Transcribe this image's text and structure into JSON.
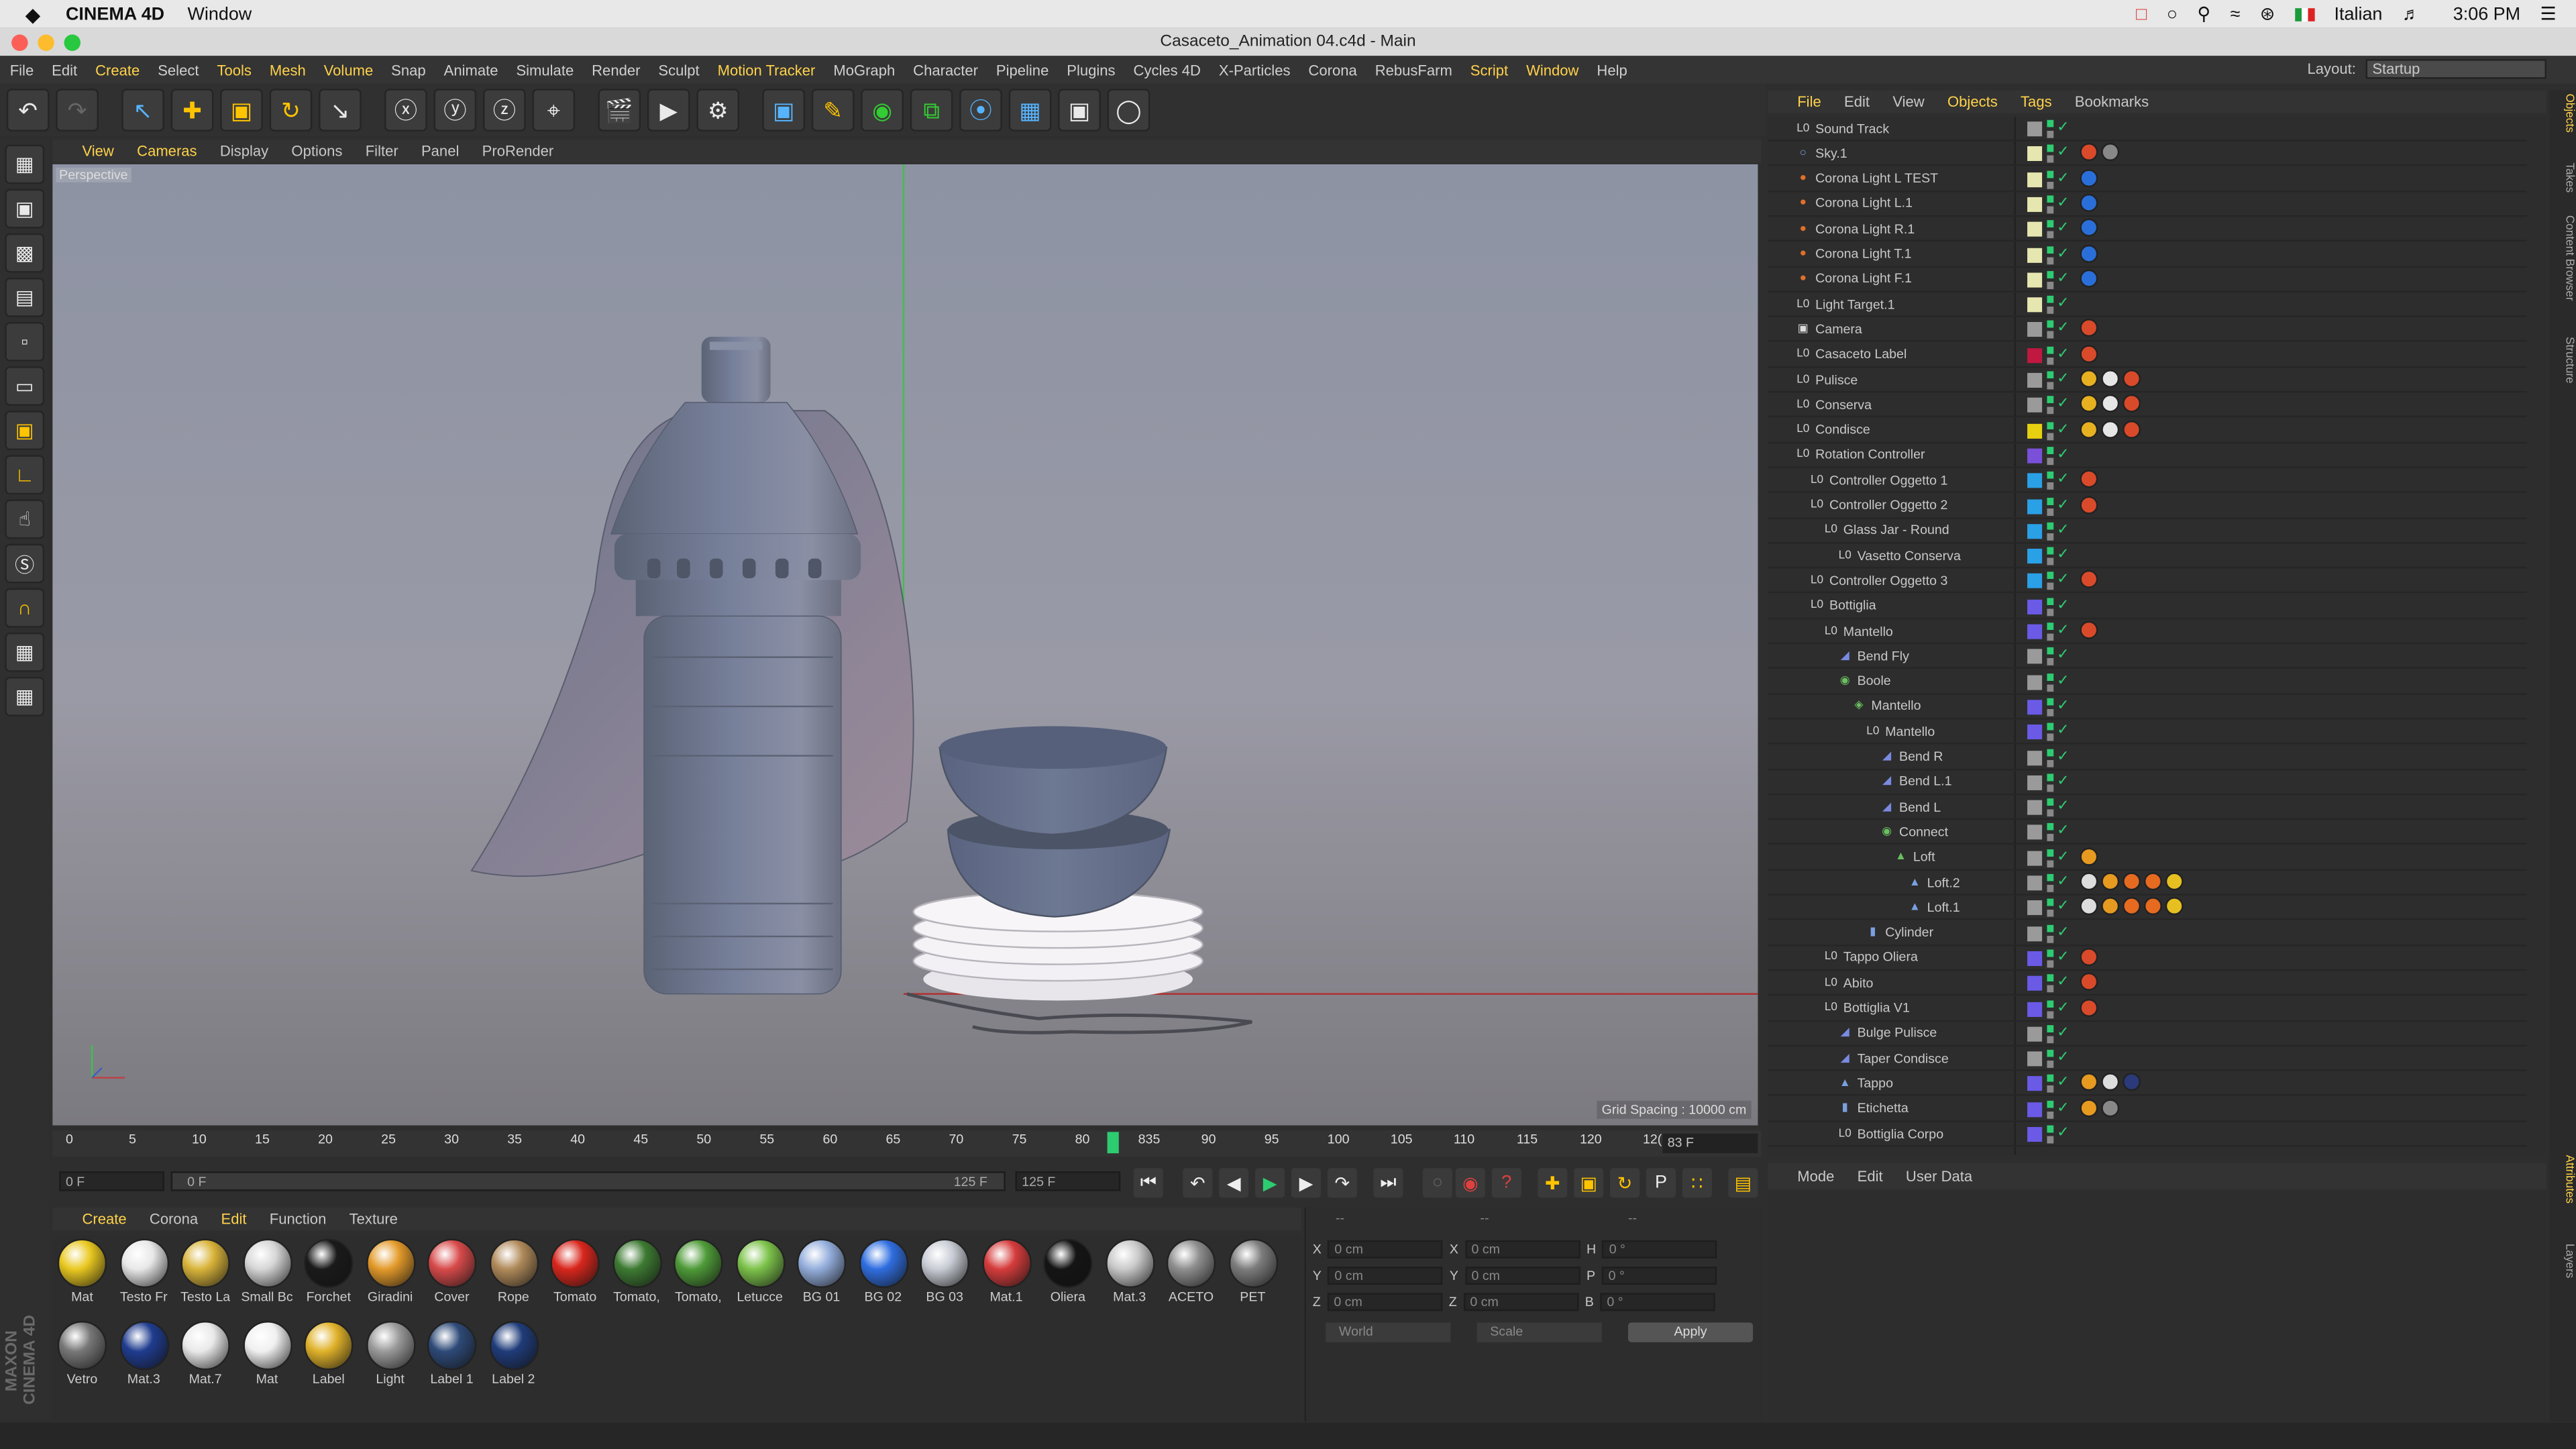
{
  "macbar": {
    "apple": "",
    "app_name": "CINEMA 4D",
    "window_menu": "Window",
    "language": "Italian",
    "time": "3:06 PM"
  },
  "titlebar": {
    "title": "Casaceto_Animation 04.c4d - Main"
  },
  "menubar": [
    "File",
    "Edit",
    "Create",
    "Select",
    "Tools",
    "Mesh",
    "Volume",
    "Snap",
    "Animate",
    "Simulate",
    "Render",
    "Sculpt",
    "Motion Tracker",
    "MoGraph",
    "Character",
    "Pipeline",
    "Plugins",
    "Cycles 4D",
    "X-Particles",
    "Corona",
    "RebusFarm",
    "Script",
    "Window",
    "Help"
  ],
  "menubar_highlight": [
    "Create",
    "Tools",
    "Mesh",
    "Volume",
    "Motion Tracker",
    "Script",
    "Window"
  ],
  "layout": {
    "label": "Layout:",
    "value": "Startup"
  },
  "viewport": {
    "menu": [
      "View",
      "Cameras",
      "Display",
      "Options",
      "Filter",
      "Panel",
      "ProRender"
    ],
    "label": "Perspective",
    "grid_spacing": "Grid Spacing : 10000 cm"
  },
  "timeline": {
    "ticks": [
      "0",
      "5",
      "10",
      "15",
      "20",
      "25",
      "30",
      "35",
      "40",
      "45",
      "50",
      "55",
      "60",
      "65",
      "70",
      "75",
      "80",
      "835",
      "90",
      "95",
      "100",
      "105",
      "110",
      "115",
      "120",
      "12("
    ],
    "current_frame": "83 F",
    "start_field": "0 F",
    "range_start": "0 F",
    "range_end": "125 F",
    "end_field": "125 F"
  },
  "materials": {
    "menu": [
      "Create",
      "Corona",
      "Edit",
      "Function",
      "Texture"
    ],
    "row1": [
      {
        "name": "Mat",
        "color": "#e9c820"
      },
      {
        "name": "Testo Fr",
        "color": "#e8e8e8"
      },
      {
        "name": "Testo La",
        "color": "#d9b43a"
      },
      {
        "name": "Small Bc",
        "color": "#d6d6d6"
      },
      {
        "name": "Forchet",
        "color": "#1a1a1a"
      },
      {
        "name": "Giradini",
        "color": "#e39a2a"
      },
      {
        "name": "Cover",
        "color": "#d84a4a"
      },
      {
        "name": "Rope",
        "color": "#b08a5a"
      },
      {
        "name": "Tomato",
        "color": "#d8261c"
      },
      {
        "name": "Tomato,",
        "color": "#3d7a32"
      },
      {
        "name": "Tomato,",
        "color": "#4e9a38"
      },
      {
        "name": "Letucce",
        "color": "#7cc24a"
      },
      {
        "name": "BG 01",
        "color": "#94aedc"
      },
      {
        "name": "BG 02",
        "color": "#2f6ee0"
      },
      {
        "name": "BG 03",
        "color": "#c8ccd4"
      },
      {
        "name": "Mat.1",
        "color": "#d63c3c"
      },
      {
        "name": "Oliera",
        "color": "#141414"
      },
      {
        "name": "Mat.3",
        "color": "#c9c9c9"
      },
      {
        "name": "ACETO",
        "color": "#8e8e8e"
      },
      {
        "name": "PET",
        "color": "#7c7c7c"
      }
    ],
    "row2": [
      {
        "name": "Vetro",
        "color": "#777777"
      },
      {
        "name": "Mat.3",
        "color": "#1f3c8f"
      },
      {
        "name": "Mat.7",
        "color": "#e9e9e9"
      },
      {
        "name": "Mat",
        "color": "#f0f0f0"
      },
      {
        "name": "Label",
        "color": "#e0b22a"
      },
      {
        "name": "Light",
        "color": "#9a9a9a"
      },
      {
        "name": "Label 1",
        "color": "#2e4a78"
      },
      {
        "name": "Label 2",
        "color": "#1f3c7a"
      }
    ]
  },
  "coords": {
    "headers": [
      "--",
      "--",
      "--"
    ],
    "rows": [
      {
        "axis": "X",
        "pos": "0 cm",
        "size_axis": "X",
        "size": "0 cm",
        "rot_axis": "H",
        "rot": "0 °"
      },
      {
        "axis": "Y",
        "pos": "0 cm",
        "size_axis": "Y",
        "size": "0 cm",
        "rot_axis": "P",
        "rot": "0 °"
      },
      {
        "axis": "Z",
        "pos": "0 cm",
        "size_axis": "Z",
        "size": "0 cm",
        "rot_axis": "B",
        "rot": "0 °"
      }
    ],
    "world": "World",
    "scale": "Scale",
    "apply": "Apply"
  },
  "objects": {
    "menu": [
      "File",
      "Edit",
      "View",
      "Objects",
      "Tags",
      "Bookmarks"
    ],
    "menu_highlight": [
      "File",
      "Objects",
      "Tags"
    ],
    "rows": [
      {
        "name": "Sound Track",
        "indent": 0,
        "icon": "null",
        "vis": "#9a9a9a",
        "tags": []
      },
      {
        "name": "Sky.1",
        "indent": 0,
        "icon": "sky",
        "vis": "#e6e6b0",
        "tags": [
          "#d94a2a",
          "#888888"
        ]
      },
      {
        "name": "Corona Light L TEST",
        "indent": 0,
        "icon": "light",
        "vis": "#e6e6b0",
        "tags": [
          "#2a6fd9"
        ]
      },
      {
        "name": "Corona Light L.1",
        "indent": 0,
        "icon": "light",
        "vis": "#e6e6b0",
        "tags": [
          "#2a6fd9"
        ]
      },
      {
        "name": "Corona Light R.1",
        "indent": 0,
        "icon": "light",
        "vis": "#e6e6b0",
        "tags": [
          "#2a6fd9"
        ]
      },
      {
        "name": "Corona Light T.1",
        "indent": 0,
        "icon": "light",
        "vis": "#e6e6b0",
        "tags": [
          "#2a6fd9"
        ]
      },
      {
        "name": "Corona Light F.1",
        "indent": 0,
        "icon": "light",
        "vis": "#e6e6b0",
        "tags": [
          "#2a6fd9"
        ]
      },
      {
        "name": "Light Target.1",
        "indent": 0,
        "icon": "null",
        "vis": "#e6e6b0",
        "tags": []
      },
      {
        "name": "Camera",
        "indent": 0,
        "icon": "camera",
        "vis": "#9a9a9a",
        "tags": [
          "#d94a2a"
        ]
      },
      {
        "name": "Casaceto Label",
        "indent": 0,
        "icon": "null",
        "vis": "#c01840",
        "tags": [
          "#d94a2a"
        ]
      },
      {
        "name": "Pulisce",
        "indent": 0,
        "icon": "null",
        "vis": "#9a9a9a",
        "tags": [
          "#e6b020",
          "#e6e6e6",
          "#d94a2a"
        ]
      },
      {
        "name": "Conserva",
        "indent": 0,
        "icon": "null",
        "vis": "#9a9a9a",
        "tags": [
          "#e6b020",
          "#e6e6e6",
          "#d94a2a"
        ]
      },
      {
        "name": "Condisce",
        "indent": 0,
        "icon": "null",
        "vis": "#e6d010",
        "tags": [
          "#e6b020",
          "#e6e6e6",
          "#d94a2a"
        ]
      },
      {
        "name": "Rotation Controller",
        "indent": 0,
        "icon": "null",
        "vis": "#7a50d9",
        "tags": []
      },
      {
        "name": "Controller Oggetto 1",
        "indent": 1,
        "icon": "null",
        "vis": "#2aa0e6",
        "tags": [
          "#d94a2a"
        ]
      },
      {
        "name": "Controller Oggetto 2",
        "indent": 1,
        "icon": "null",
        "vis": "#2aa0e6",
        "tags": [
          "#d94a2a"
        ]
      },
      {
        "name": "Glass Jar - Round",
        "indent": 2,
        "icon": "null",
        "vis": "#2aa0e6",
        "tags": []
      },
      {
        "name": "Vasetto Conserva",
        "indent": 3,
        "icon": "null",
        "vis": "#2aa0e6",
        "tags": []
      },
      {
        "name": "Controller Oggetto 3",
        "indent": 1,
        "icon": "null",
        "vis": "#2aa0e6",
        "tags": [
          "#d94a2a"
        ]
      },
      {
        "name": "Bottiglia",
        "indent": 1,
        "icon": "null",
        "vis": "#6a5ae6",
        "tags": []
      },
      {
        "name": "Mantello",
        "indent": 2,
        "icon": "null",
        "vis": "#6a5ae6",
        "tags": [
          "#d94a2a"
        ]
      },
      {
        "name": "Bend Fly",
        "indent": 3,
        "icon": "deformer",
        "vis": "#9a9a9a",
        "tags": []
      },
      {
        "name": "Boole",
        "indent": 3,
        "icon": "boole",
        "vis": "#9a9a9a",
        "tags": []
      },
      {
        "name": "Mantello",
        "indent": 4,
        "icon": "cloth",
        "vis": "#6a5ae6",
        "tags": []
      },
      {
        "name": "Mantello",
        "indent": 5,
        "icon": "null",
        "vis": "#6a5ae6",
        "tags": []
      },
      {
        "name": "Bend R",
        "indent": 6,
        "icon": "deformer",
        "vis": "#9a9a9a",
        "tags": []
      },
      {
        "name": "Bend L.1",
        "indent": 6,
        "icon": "deformer",
        "vis": "#9a9a9a",
        "tags": []
      },
      {
        "name": "Bend L",
        "indent": 6,
        "icon": "deformer",
        "vis": "#9a9a9a",
        "tags": []
      },
      {
        "name": "Connect",
        "indent": 6,
        "icon": "connect",
        "vis": "#9a9a9a",
        "tags": []
      },
      {
        "name": "Loft",
        "indent": 7,
        "icon": "loft",
        "vis": "#9a9a9a",
        "tags": [
          "#e69a20"
        ]
      },
      {
        "name": "Loft.2",
        "indent": 8,
        "icon": "spline",
        "vis": "#9a9a9a",
        "tags": [
          "#dddddd",
          "#e69a20",
          "#e66a20",
          "#e66a20",
          "#e6c020"
        ]
      },
      {
        "name": "Loft.1",
        "indent": 8,
        "icon": "spline",
        "vis": "#9a9a9a",
        "tags": [
          "#dddddd",
          "#e69a20",
          "#e66a20",
          "#e66a20",
          "#e6c020"
        ]
      },
      {
        "name": "Cylinder",
        "indent": 5,
        "icon": "cylinder",
        "vis": "#9a9a9a",
        "tags": []
      },
      {
        "name": "Tappo Oliera",
        "indent": 2,
        "icon": "null",
        "vis": "#6a5ae6",
        "tags": [
          "#d94a2a"
        ]
      },
      {
        "name": "Abito",
        "indent": 2,
        "icon": "null",
        "vis": "#6a5ae6",
        "tags": [
          "#d94a2a"
        ]
      },
      {
        "name": "Bottiglia V1",
        "indent": 2,
        "icon": "null",
        "vis": "#6a5ae6",
        "tags": [
          "#d94a2a"
        ]
      },
      {
        "name": "Bulge Pulisce",
        "indent": 3,
        "icon": "deformer",
        "vis": "#9a9a9a",
        "tags": []
      },
      {
        "name": "Taper Condisce",
        "indent": 3,
        "icon": "deformer",
        "vis": "#9a9a9a",
        "tags": []
      },
      {
        "name": "Tappo",
        "indent": 3,
        "icon": "spline",
        "vis": "#6a5ae6",
        "tags": [
          "#e69a20",
          "#dddddd",
          "#2a3a7a"
        ]
      },
      {
        "name": "Etichetta",
        "indent": 3,
        "icon": "cylinder",
        "vis": "#6a5ae6",
        "tags": [
          "#e69a20",
          "#888888"
        ]
      },
      {
        "name": "Bottiglia Corpo",
        "indent": 3,
        "icon": "null",
        "vis": "#6a5ae6",
        "tags": []
      }
    ]
  },
  "attributes": {
    "menu": [
      "Mode",
      "Edit",
      "User Data"
    ]
  },
  "sidetabs": [
    "Objects",
    "Takes",
    "Content Browser",
    "Structure",
    "Attributes",
    "Layers"
  ]
}
